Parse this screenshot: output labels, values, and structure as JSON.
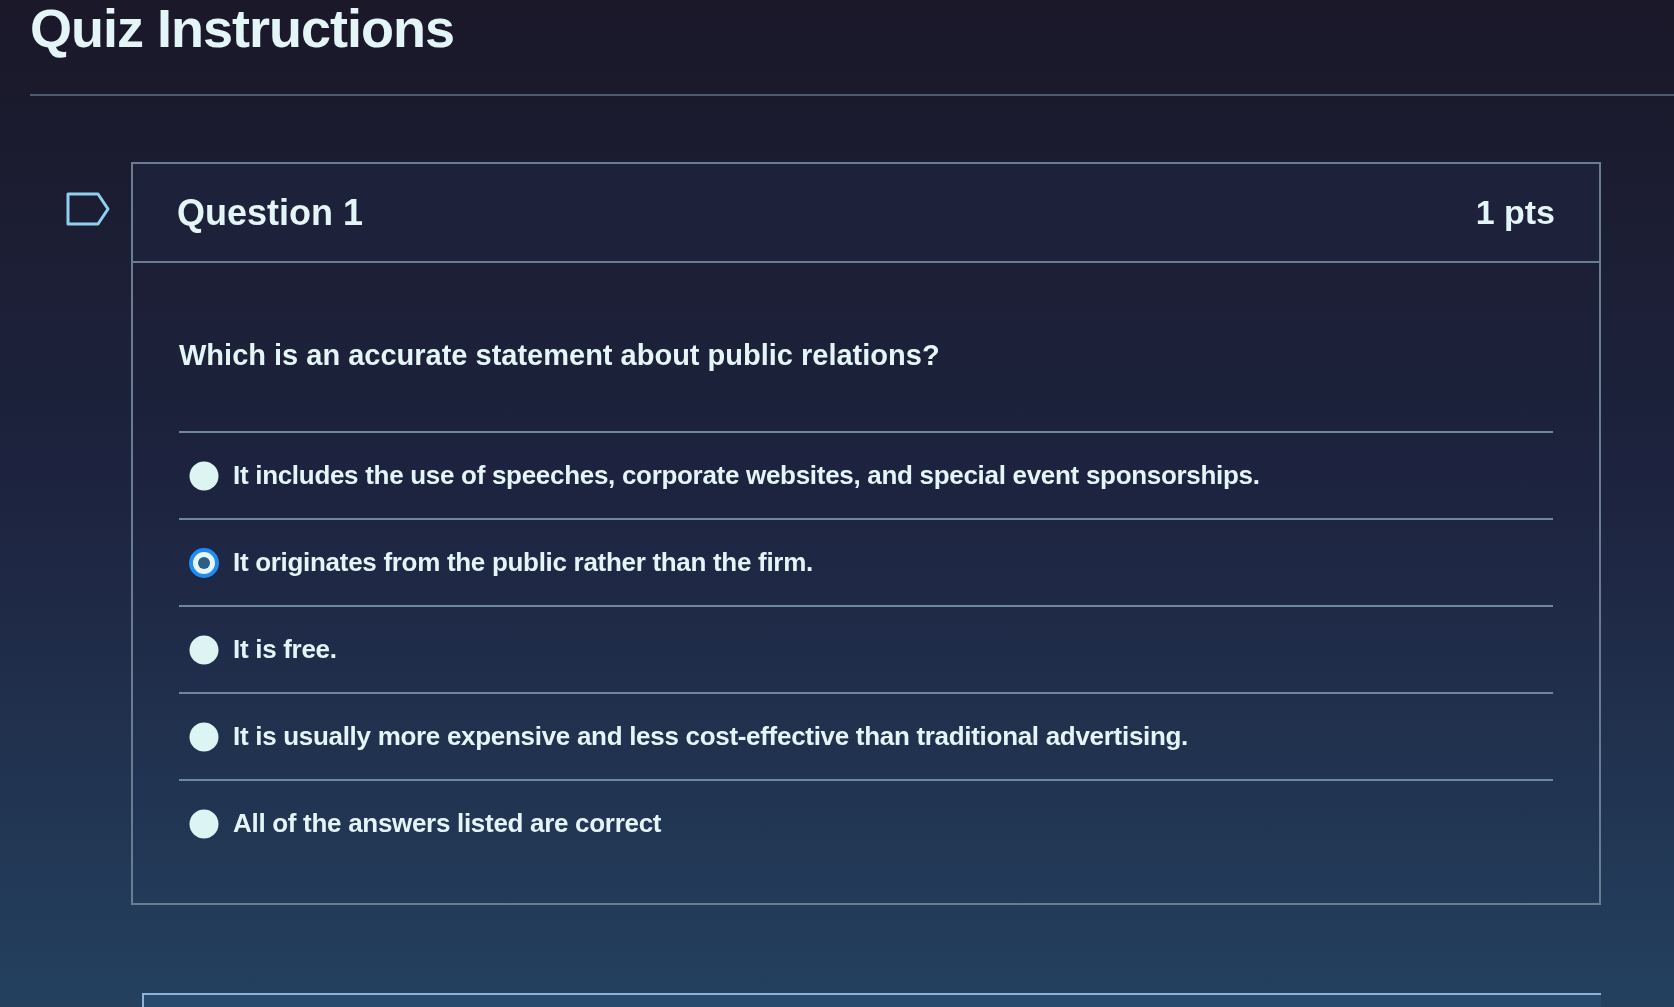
{
  "page_title": "Quiz Instructions",
  "question": {
    "title": "Question 1",
    "points": "1 pts",
    "text": "Which is an accurate statement about public relations?",
    "answers": [
      {
        "label": "It includes the use of speeches, corporate websites, and special event sponsorships.",
        "selected": false
      },
      {
        "label": "It originates from the public rather than the firm.",
        "selected": true
      },
      {
        "label": "It is free.",
        "selected": false
      },
      {
        "label": "It is usually more expensive and less cost-effective than traditional advertising.",
        "selected": false
      },
      {
        "label": "All of the answers listed are correct",
        "selected": false
      }
    ]
  }
}
